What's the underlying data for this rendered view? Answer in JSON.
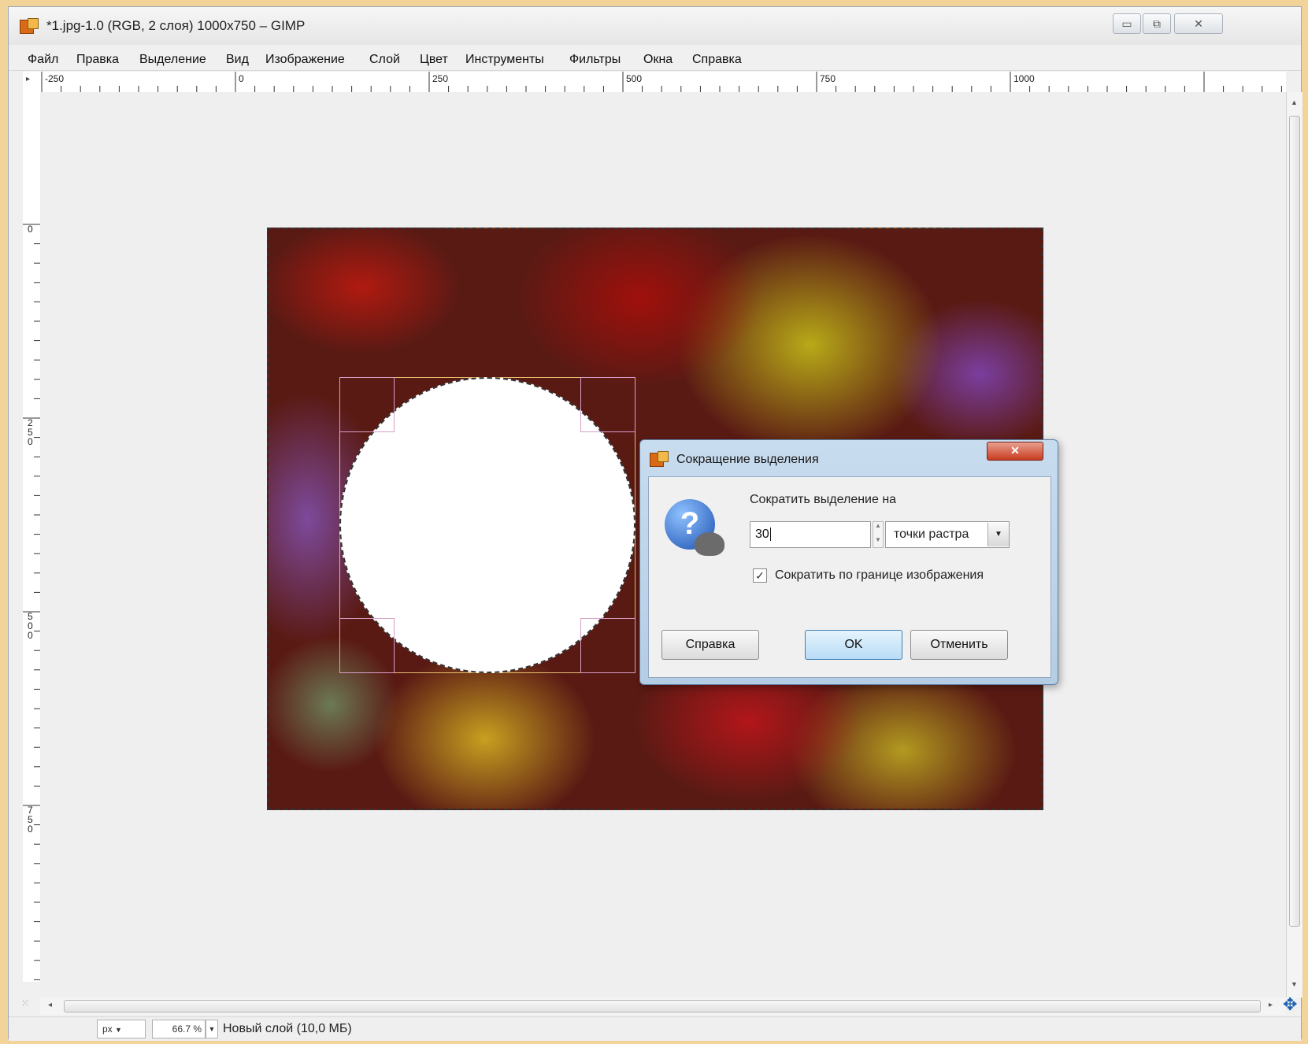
{
  "window": {
    "title": "*1.jpg-1.0 (RGB, 2 слоя) 1000x750 – GIMP",
    "controls": {
      "minimize": "▭",
      "restore": "⧉",
      "close": "✕"
    }
  },
  "menu": [
    "Файл",
    "Правка",
    "Выделение",
    "Вид",
    "Изображение",
    "Слой",
    "Цвет",
    "Инструменты",
    "Фильтры",
    "Окна",
    "Справка"
  ],
  "rulers": {
    "horizontal": [
      "-250",
      "0",
      "250",
      "500",
      "750",
      "1000"
    ],
    "vertical": [
      "0",
      "250",
      "500",
      "750"
    ]
  },
  "statusbar": {
    "unit": "px",
    "zoom": "66.7 %",
    "layer_info": "Новый слой (10,0 МБ)"
  },
  "dialog": {
    "title": "Сокращение выделения",
    "prompt": "Сократить выделение на",
    "amount": "30",
    "unit": "точки растра",
    "checkbox_label": "Сократить по границе изображения",
    "checkbox_checked": true,
    "buttons": {
      "help": "Справка",
      "ok": "OK",
      "cancel": "Отменить"
    }
  }
}
